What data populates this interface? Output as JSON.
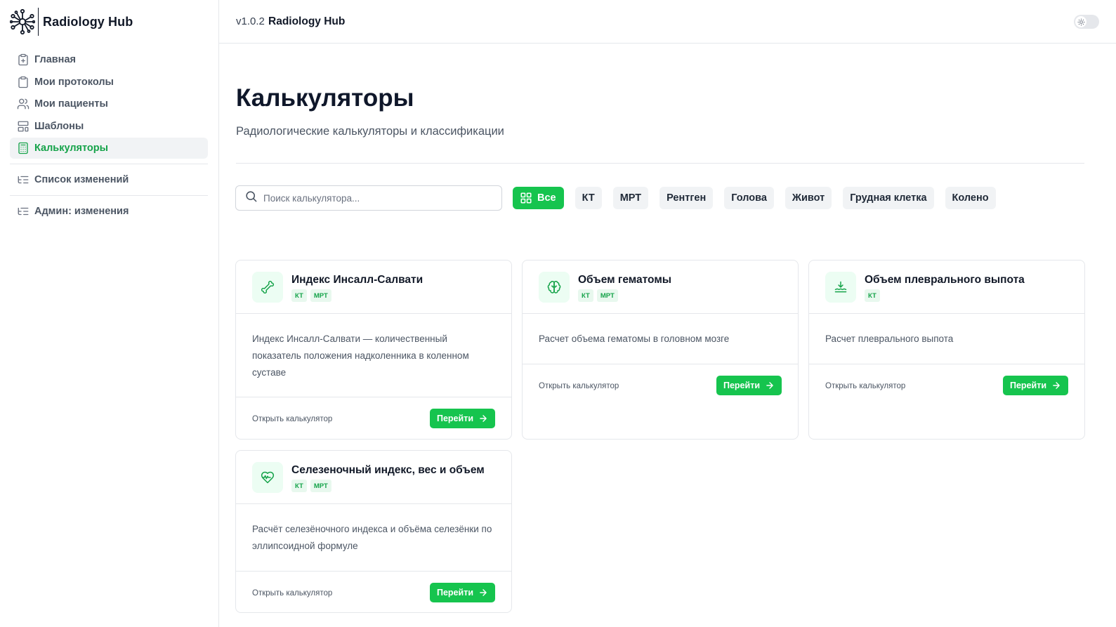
{
  "brand": {
    "name": "Radiology Hub"
  },
  "header": {
    "version": "v1.0.2",
    "title": "Radiology Hub"
  },
  "sidebar": {
    "items": [
      {
        "label": "Главная",
        "icon": "clipboard-plus-icon"
      },
      {
        "label": "Мои протоколы",
        "icon": "clipboard-icon"
      },
      {
        "label": "Мои пациенты",
        "icon": "users-icon"
      },
      {
        "label": "Шаблоны",
        "icon": "layout-template-icon"
      },
      {
        "label": "Калькуляторы",
        "icon": "calculator-icon",
        "active": true
      }
    ],
    "extra": [
      {
        "label": "Список изменений",
        "icon": "list-tree-icon"
      },
      {
        "label": "Админ: изменения",
        "icon": "list-tree-icon"
      }
    ]
  },
  "main": {
    "title": "Калькуляторы",
    "subtitle": "Радиологические калькуляторы и классификации",
    "search": {
      "placeholder": "Поиск калькулятора...",
      "value": ""
    },
    "filters": [
      "Все",
      "КТ",
      "МРТ",
      "Рентген",
      "Голова",
      "Живот",
      "Грудная клетка",
      "Колено"
    ],
    "active_filter": "Все"
  },
  "cards": [
    {
      "title": "Индекс Инсалл-Салвати",
      "tags": [
        "КТ",
        "МРТ"
      ],
      "icon": "bone-icon",
      "description": "Индекс Инсалл-Салвати — количественный показатель положения надколенника в коленном суставе",
      "footer": "Открыть калькулятор",
      "button": "Перейти"
    },
    {
      "title": "Объем гематомы",
      "tags": [
        "КТ",
        "МРТ"
      ],
      "icon": "brain-icon",
      "description": "Расчет объема гематомы в головном мозге",
      "footer": "Открыть калькулятор",
      "button": "Перейти"
    },
    {
      "title": "Объем плеврального выпота",
      "tags": [
        "КТ"
      ],
      "icon": "fluid-level-icon",
      "description": "Расчет плеврального выпота",
      "footer": "Открыть калькулятор",
      "button": "Перейти"
    },
    {
      "title": "Селезеночный индекс, вес и объем",
      "tags": [
        "КТ",
        "МРТ"
      ],
      "icon": "heart-pulse-icon",
      "description": "Расчёт селезёночного индекса и объёма селезёнки по эллипсоидной формуле",
      "footer": "Открыть калькулятор",
      "button": "Перейти"
    }
  ],
  "colors": {
    "accent": "#16c44e",
    "accent_text": "#16a34a",
    "accent_bg": "#ecfdf3"
  }
}
